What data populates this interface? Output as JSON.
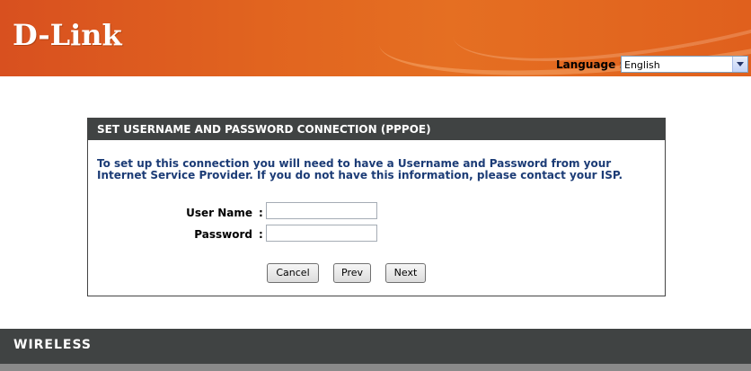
{
  "header": {
    "logo": "D-Link",
    "language_label": "Language :",
    "language_value": "English"
  },
  "panel": {
    "title": "SET USERNAME AND PASSWORD CONNECTION (PPPOE)",
    "description": "To set up this connection you will need to have a Username and Password from your Internet Service Provider. If you do not have this information, please contact your ISP.",
    "username_label": "User Name",
    "password_label": "Password",
    "colon": ":",
    "username_value": "",
    "password_value": "",
    "buttons": {
      "cancel": "Cancel",
      "prev": "Prev",
      "next": "Next"
    }
  },
  "footer": {
    "label": "WIRELESS"
  },
  "colors": {
    "header_orange": "#e1641f",
    "panel_title_bg": "#404343",
    "description_text": "#1c3c76",
    "footer_bg": "#404343"
  }
}
